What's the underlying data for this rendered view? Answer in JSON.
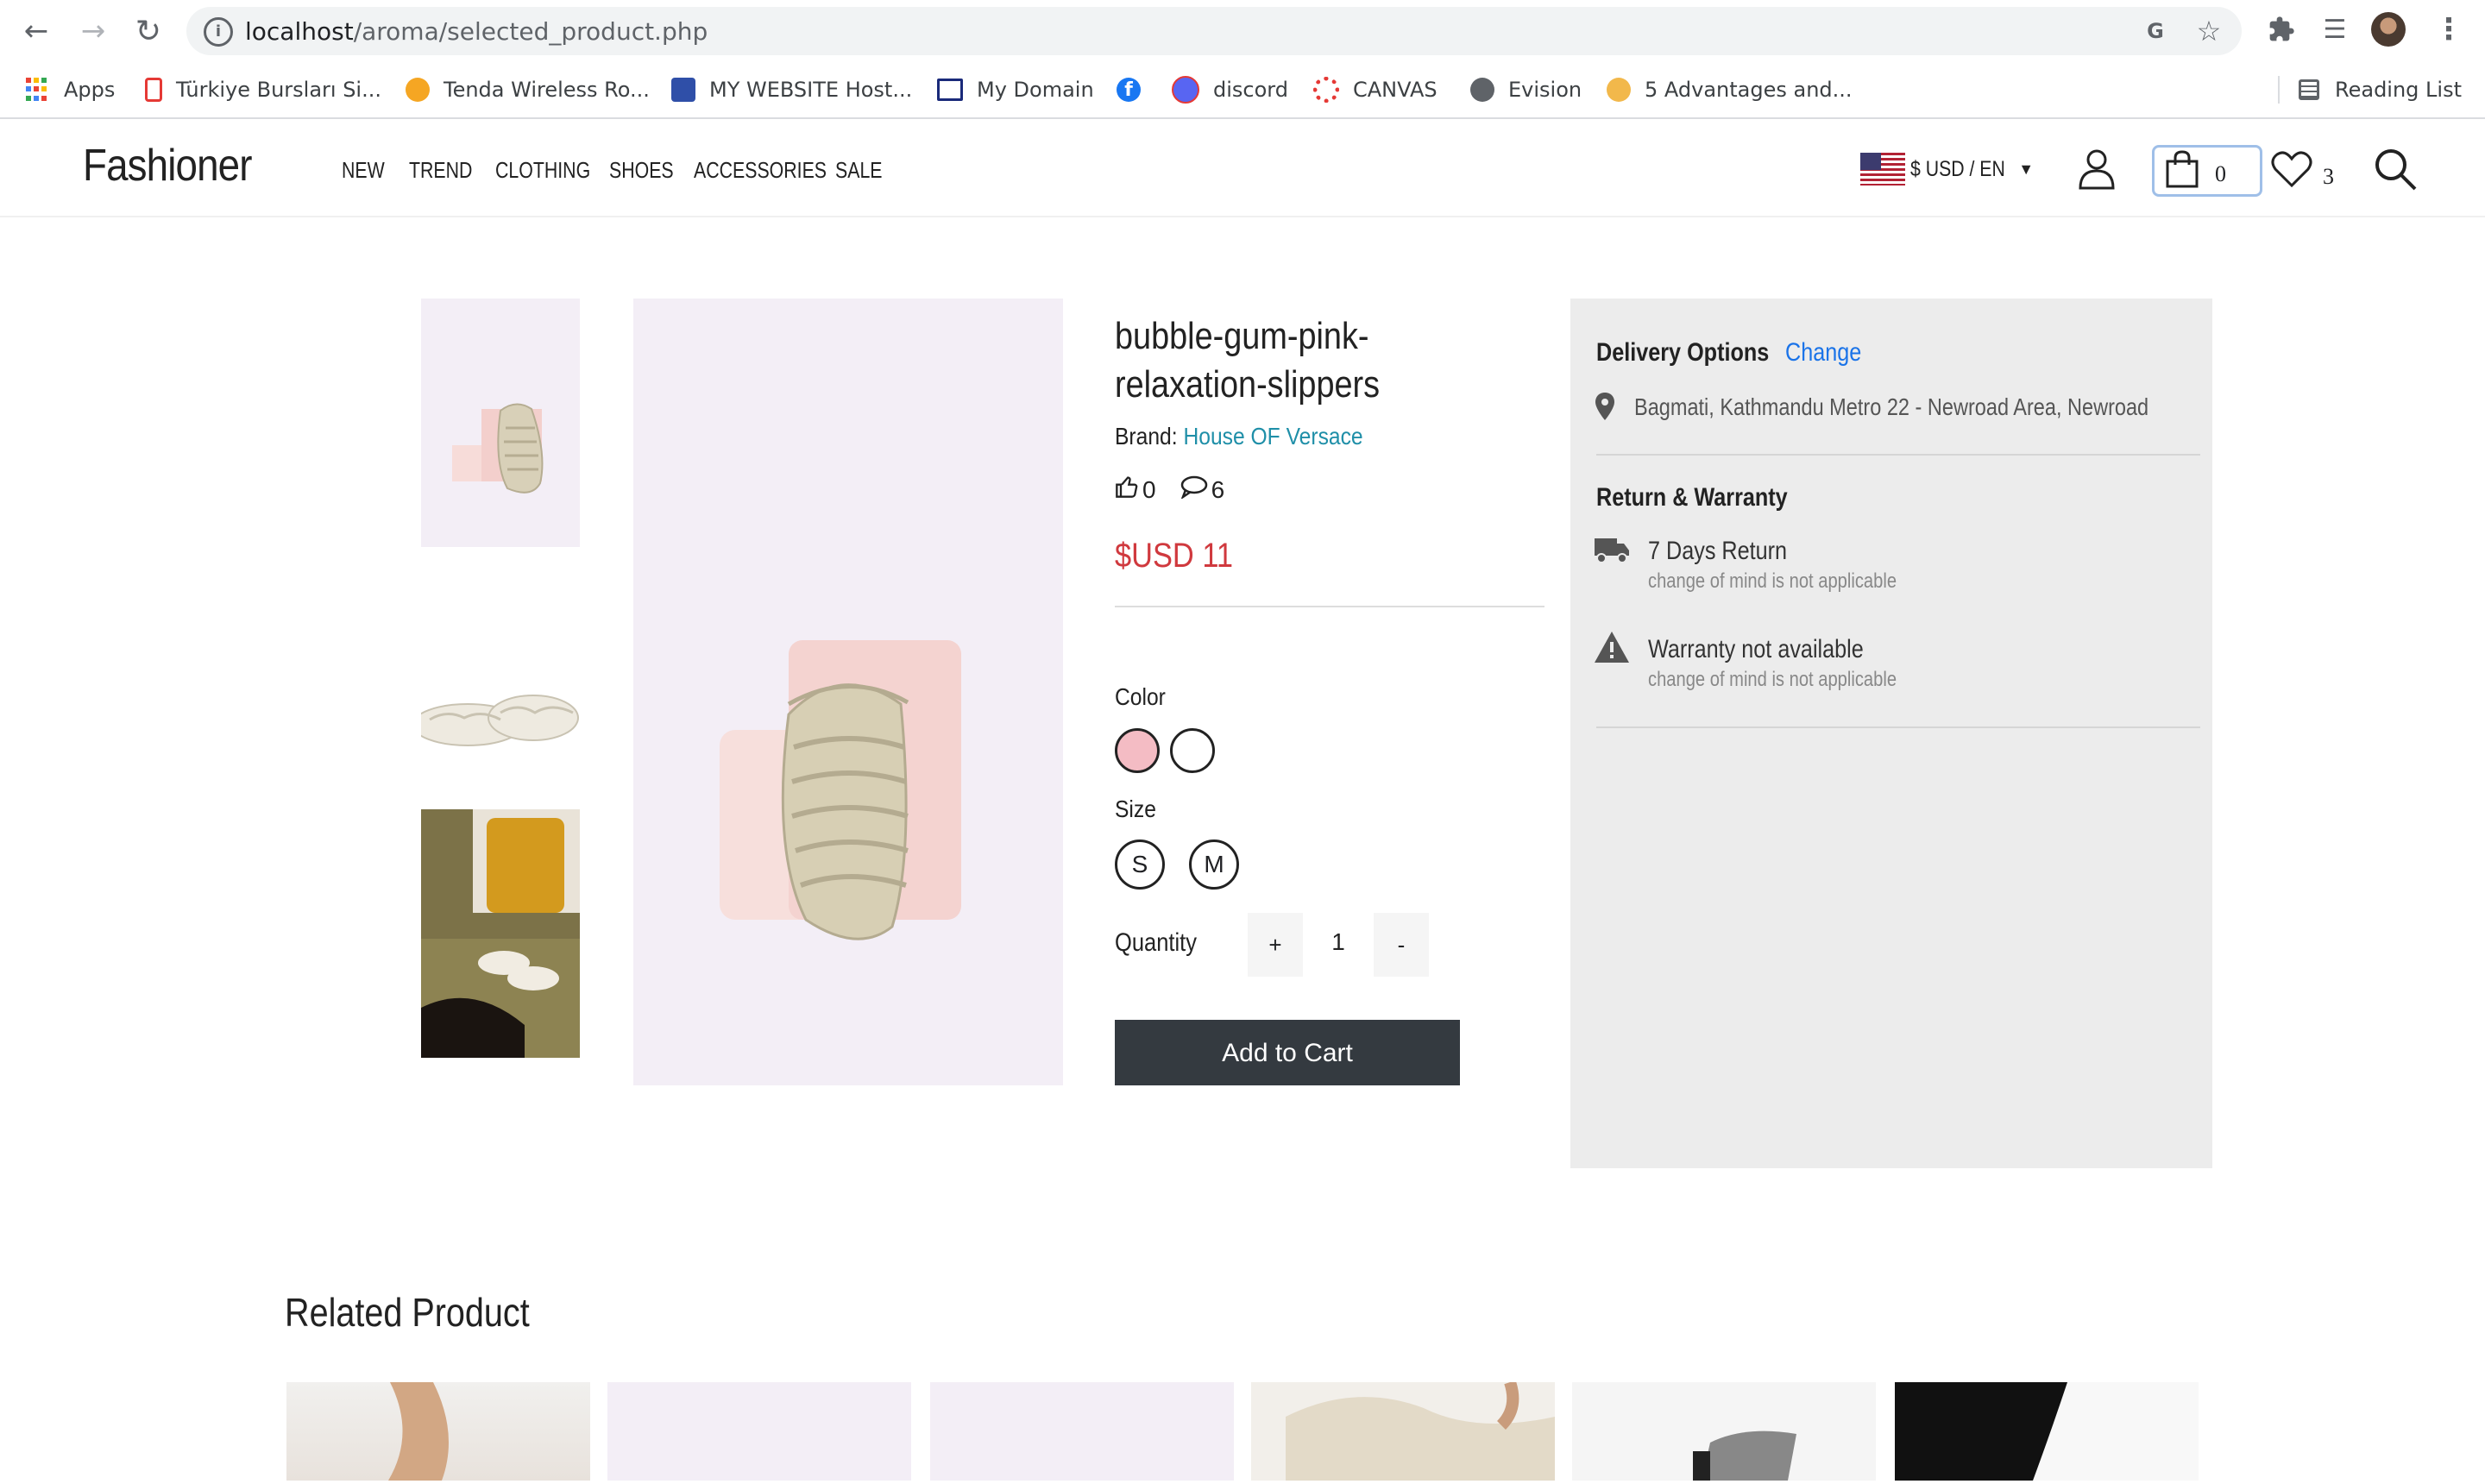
{
  "browser": {
    "url_host": "localhost",
    "url_path": "/aroma/selected_product.php",
    "bookmarks": [
      {
        "label": "Apps"
      },
      {
        "label": "Türkiye Bursları Si..."
      },
      {
        "label": "Tenda Wireless Ro..."
      },
      {
        "label": "MY WEBSITE Host..."
      },
      {
        "label": "My Domain"
      },
      {
        "label": ""
      },
      {
        "label": "discord"
      },
      {
        "label": "CANVAS"
      },
      {
        "label": "Evision"
      },
      {
        "label": "5 Advantages and..."
      }
    ],
    "reading_list": "Reading List"
  },
  "site": {
    "logo": "Fashioner",
    "menu": [
      "NEW",
      "TREND",
      "CLOTHING",
      "SHOES",
      "ACCESSORIES",
      "SALE"
    ],
    "currency": "$ USD / EN",
    "cart_count": "0",
    "wishlist_count": "3"
  },
  "product": {
    "title": "bubble-gum-pink-relaxation-slippers",
    "brand_label": "Brand:",
    "brand": "House OF Versace",
    "likes": "0",
    "comments": "6",
    "price": "$USD 11",
    "color_label": "Color",
    "colors": [
      "#f4bcc4",
      "#ffffff"
    ],
    "size_label": "Size",
    "sizes": [
      "S",
      "M"
    ],
    "quantity_label": "Quantity",
    "quantity": "1",
    "plus": "+",
    "minus": "-",
    "add_to_cart": "Add to Cart"
  },
  "delivery": {
    "title": "Delivery Options",
    "change": "Change",
    "address": "Bagmati, Kathmandu Metro 22 - Newroad Area, Newroad",
    "return_title": "Return & Warranty",
    "return_main": "7 Days Return",
    "return_sub": "change of mind is not applicable",
    "warranty_main": "Warranty not available",
    "warranty_sub": "change of mind is not applicable"
  },
  "related": {
    "title": "Related Product"
  }
}
